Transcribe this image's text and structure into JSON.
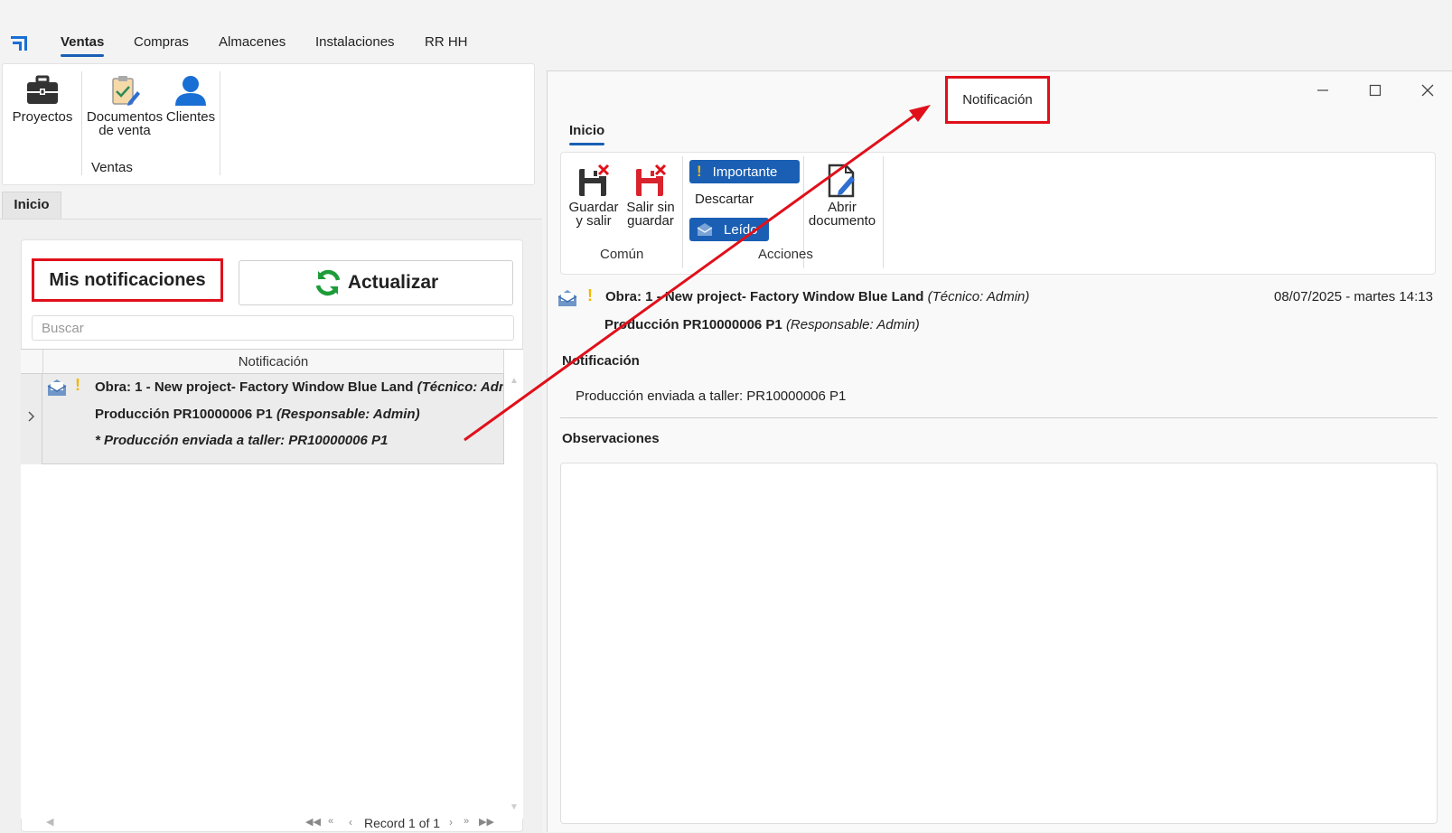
{
  "nav": {
    "logo": "app-logo-icon",
    "tabs": [
      "Ventas",
      "Compras",
      "Almacenes",
      "Instalaciones",
      "RR HH"
    ]
  },
  "ribbon": {
    "buttons": [
      {
        "label1": "Proyectos",
        "label2": "",
        "icon": "briefcase-icon"
      },
      {
        "label1": "Documentos",
        "label2": "de venta",
        "icon": "clipboard-check-icon"
      },
      {
        "label1": "Clientes",
        "label2": "",
        "icon": "user-icon"
      }
    ],
    "group_label": "Ventas"
  },
  "inicio_tab": "Inicio",
  "notifications": {
    "title": "Mis notificaciones",
    "refresh_label": "Actualizar",
    "search_placeholder": "Buscar",
    "column_header": "Notificación",
    "row": {
      "line1_bold": "Obra: 1 - New project- Factory Window Blue Land",
      "line1_italic": "(Técnico: Admin)",
      "line2_bold": "Producción  PR10000006 P1",
      "line2_italic": "(Responsable: Admin)",
      "line3": "* Producción enviada a taller: PR10000006 P1"
    },
    "record_text": "Record 1 of 1"
  },
  "dialog": {
    "title": "Notificación",
    "tab": "Inicio",
    "buttons": {
      "guardar1": "Guardar",
      "guardar2": "y salir",
      "salir1": "Salir sin",
      "salir2": "guardar",
      "importante": "Importante",
      "descartar": "Descartar",
      "leido": "Leído",
      "abrir1": "Abrir",
      "abrir2": "documento"
    },
    "groups": {
      "comun": "Común",
      "acciones": "Acciones"
    },
    "header": {
      "obra_bold": "Obra: 1 - New project- Factory Window Blue Land",
      "obra_italic": "(Técnico: Admin)",
      "date": "08/07/2025 - martes  14:13",
      "prod_bold": "Producción  PR10000006 P1",
      "prod_italic": "(Responsable: Admin)"
    },
    "notificacion_label": "Notificación",
    "notificacion_text": "Producción enviada a taller: PR10000006 P1",
    "observaciones_label": "Observaciones"
  },
  "colors": {
    "accent": "#1a5fb4",
    "highlight": "#e0101a",
    "refresh": "#1e9c3a",
    "warning": "#f2b705"
  }
}
